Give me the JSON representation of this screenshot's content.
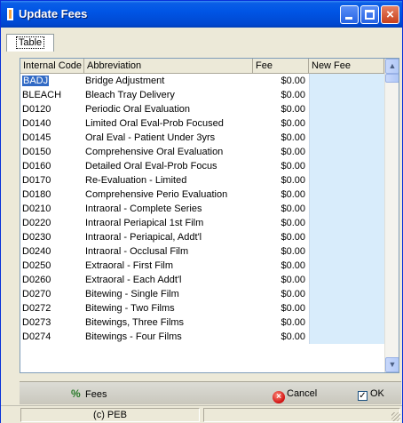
{
  "window": {
    "title": "Update Fees",
    "controls": {
      "minimize": "minimize",
      "maximize": "maximize",
      "close": "×"
    }
  },
  "tabs": [
    {
      "label": "Table",
      "active": true
    }
  ],
  "grid": {
    "columns": [
      "Internal Code",
      "Abbreviation",
      "Fee",
      "New Fee"
    ],
    "rows": [
      {
        "code": "BADJ",
        "abbreviation": "Bridge Adjustment",
        "fee": "$0.00",
        "new_fee": ""
      },
      {
        "code": "BLEACH",
        "abbreviation": "Bleach Tray Delivery",
        "fee": "$0.00",
        "new_fee": ""
      },
      {
        "code": "D0120",
        "abbreviation": "Periodic Oral Evaluation",
        "fee": "$0.00",
        "new_fee": ""
      },
      {
        "code": "D0140",
        "abbreviation": "Limited Oral Eval-Prob Focused",
        "fee": "$0.00",
        "new_fee": ""
      },
      {
        "code": "D0145",
        "abbreviation": "Oral Eval - Patient Under 3yrs",
        "fee": "$0.00",
        "new_fee": ""
      },
      {
        "code": "D0150",
        "abbreviation": "Comprehensive Oral Evaluation",
        "fee": "$0.00",
        "new_fee": ""
      },
      {
        "code": "D0160",
        "abbreviation": "Detailed Oral Eval-Prob Focus",
        "fee": "$0.00",
        "new_fee": ""
      },
      {
        "code": "D0170",
        "abbreviation": "Re-Evaluation - Limited",
        "fee": "$0.00",
        "new_fee": ""
      },
      {
        "code": "D0180",
        "abbreviation": "Comprehensive Perio Evaluation",
        "fee": "$0.00",
        "new_fee": ""
      },
      {
        "code": "D0210",
        "abbreviation": "Intraoral - Complete Series",
        "fee": "$0.00",
        "new_fee": ""
      },
      {
        "code": "D0220",
        "abbreviation": "Intraoral Periapical 1st Film",
        "fee": "$0.00",
        "new_fee": ""
      },
      {
        "code": "D0230",
        "abbreviation": "Intraoral - Periapical, Addt'l",
        "fee": "$0.00",
        "new_fee": ""
      },
      {
        "code": "D0240",
        "abbreviation": "Intraoral - Occlusal Film",
        "fee": "$0.00",
        "new_fee": ""
      },
      {
        "code": "D0250",
        "abbreviation": "Extraoral - First Film",
        "fee": "$0.00",
        "new_fee": ""
      },
      {
        "code": "D0260",
        "abbreviation": "Extraoral - Each Addt'l",
        "fee": "$0.00",
        "new_fee": ""
      },
      {
        "code": "D0270",
        "abbreviation": "Bitewing - Single Film",
        "fee": "$0.00",
        "new_fee": ""
      },
      {
        "code": "D0272",
        "abbreviation": "Bitewing - Two Films",
        "fee": "$0.00",
        "new_fee": ""
      },
      {
        "code": "D0273",
        "abbreviation": "Bitewings, Three Films",
        "fee": "$0.00",
        "new_fee": ""
      },
      {
        "code": "D0274",
        "abbreviation": "Bitewings - Four Films",
        "fee": "$0.00",
        "new_fee": ""
      }
    ]
  },
  "toolbar": {
    "fees_label": "Fees",
    "cancel_label": "Cancel",
    "ok_label": "OK"
  },
  "status": {
    "panel1": "(c) PEB",
    "panel2": ""
  },
  "colors": {
    "titlebar": "#0055e5",
    "selection": "#316ac5",
    "new_fee_bg": "#d8ecfb"
  }
}
